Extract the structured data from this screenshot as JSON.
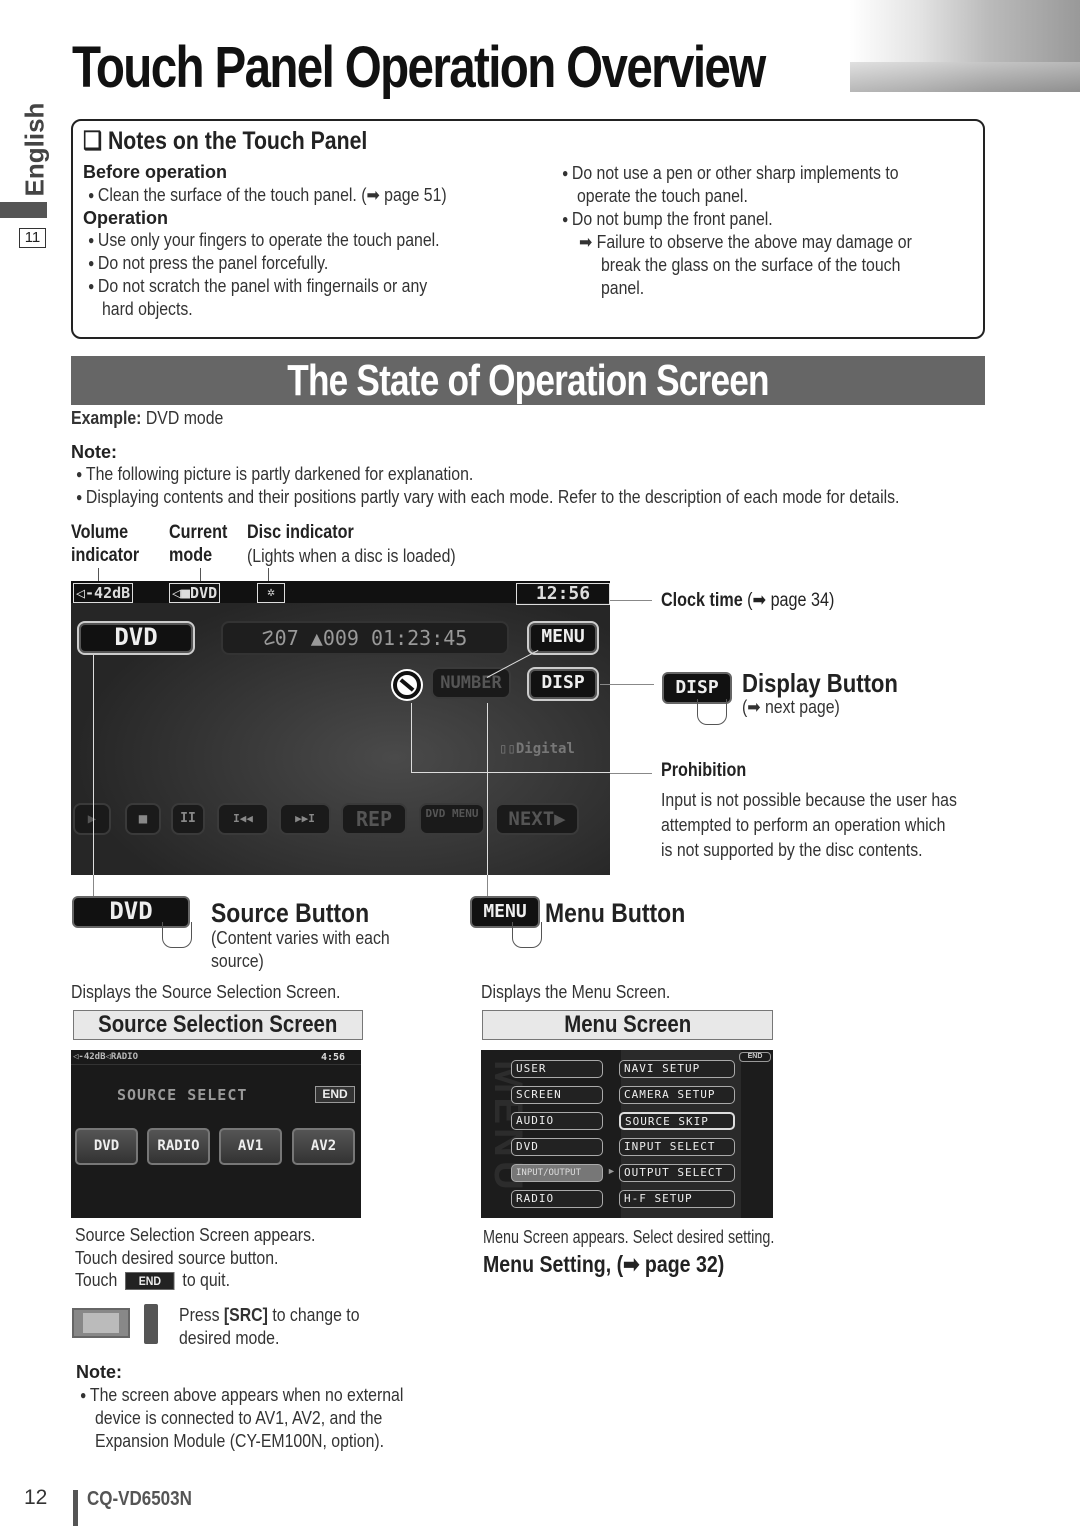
{
  "page": {
    "title": "Touch Panel Operation Overview",
    "side_language": "English",
    "side_section_number": "11",
    "page_number": "12",
    "model": "CQ-VD6503N"
  },
  "notes": {
    "title": "❑ Notes on the Touch Panel",
    "before_heading": "Before operation",
    "before_items": [
      "Clean the surface of the touch panel.  (➡ page 51)"
    ],
    "operation_heading": "Operation",
    "operation_items": [
      "Use only your fingers to operate the touch panel.",
      "Do not press the panel forcefully.",
      "Do not scratch the panel with fingernails or any",
      "hard objects."
    ],
    "right_items": [
      "Do not use a pen or other sharp implements to",
      "operate the touch panel.",
      "Do not bump the front panel.",
      "➡ Failure to observe the above may damage or",
      "break the glass on the surface of the touch",
      "panel."
    ]
  },
  "state": {
    "banner": "The State of Operation Screen",
    "example_label": "Example:",
    "example_value": "DVD mode",
    "note_label": "Note:",
    "note_items": [
      "The following picture is partly darkened for explanation.",
      "Displaying contents and their positions partly vary with each mode. Refer to the description of each mode for details."
    ],
    "callouts": {
      "volume": [
        "Volume",
        "indicator"
      ],
      "mode": [
        "Current",
        "mode"
      ],
      "disc": "Disc indicator",
      "disc_note": "(Lights when a disc is loaded)",
      "clock": "Clock time",
      "clock_ref": "(➡ page 34)",
      "display_title": "Display Button",
      "display_ref": "(➡ next page)",
      "prohibition_title": "Prohibition",
      "prohibition_text": [
        "Input is not possible because the user has",
        "attempted to perform an operation which",
        "is not supported by the disc contents."
      ]
    },
    "screen": {
      "volume": "◁-42dB",
      "mode": "◁■DVD",
      "clock": "12:56",
      "source_btn": "DVD",
      "info": "☡07  ▲009  01:23:45",
      "menu_btn": "MENU",
      "number_btn": "NUMBER",
      "disp_btn": "DISP",
      "digital": "▯▯Digital",
      "controls": [
        "▶",
        "■",
        "II",
        "I◀◀",
        "▶▶I",
        "REP",
        "DVD MENU",
        "NEXT▶"
      ]
    }
  },
  "source": {
    "btn": "DVD",
    "title": "Source Button",
    "note": [
      "(Content varies with each",
      "source)"
    ],
    "desc": "Displays the Source Selection Screen.",
    "header": "Source Selection Screen",
    "screen": {
      "status": "◁-42dB◁RADIO",
      "clock": "4:56",
      "heading": "SOURCE SELECT",
      "end": "END",
      "buttons": [
        "DVD",
        "RADIO",
        "AV1",
        "AV2"
      ]
    },
    "after": [
      "Source Selection Screen appears.",
      "Touch desired source button."
    ],
    "touch_pre": "Touch",
    "touch_btn": "END",
    "touch_post": "to quit.",
    "press_pre": "Press",
    "press_key": "[SRC]",
    "press_post": "to change to",
    "press_line2": "desired mode.",
    "note_label": "Note:",
    "note_lines": [
      "The screen above appears when no external",
      "device is connected to AV1, AV2, and the",
      "Expansion Module (CY-EM100N, option)."
    ]
  },
  "menu": {
    "btn": "MENU",
    "title": "Menu Button",
    "desc": "Displays the Menu Screen.",
    "header": "Menu Screen",
    "screen": {
      "end": "END",
      "left": [
        "USER",
        "SCREEN",
        "AUDIO",
        "DVD",
        "INPUT/OUTPUT",
        "RADIO"
      ],
      "right": [
        "NAVI  SETUP",
        "CAMERA SETUP",
        "SOURCE  SKIP",
        "INPUT SELECT",
        "OUTPUT SELECT",
        "H-F  SETUP"
      ],
      "selected_left": "INPUT/OUTPUT"
    },
    "after": "Menu Screen appears. Select desired setting.",
    "setting": "Menu Setting, (➡ page 32)"
  }
}
